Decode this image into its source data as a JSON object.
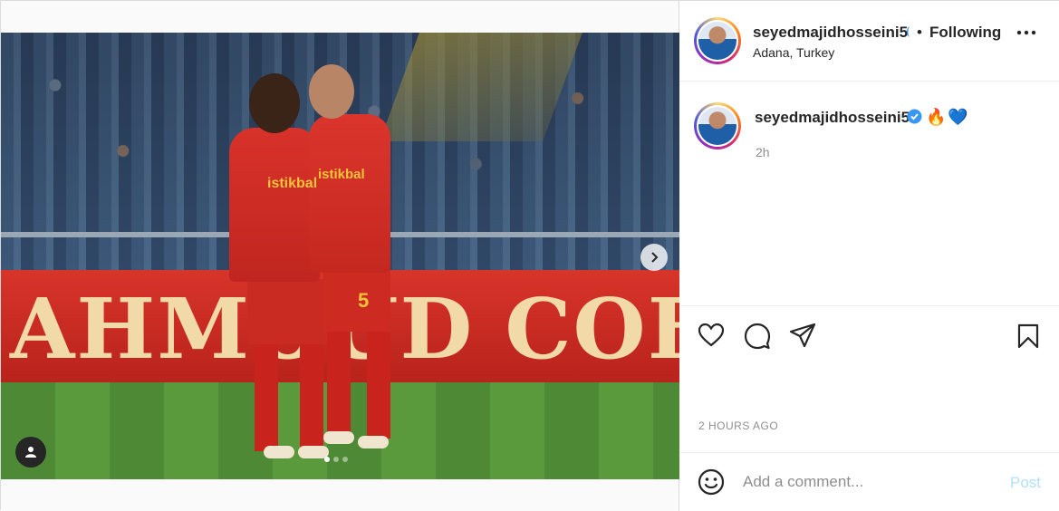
{
  "post": {
    "media": {
      "board_text": "AHMOUD COFF",
      "sponsor_text": "istikbal",
      "sponsor_text_2": "istikbal",
      "jersey_number": "5",
      "carousel": {
        "count": 3,
        "active_index": 0
      }
    },
    "header": {
      "username": "seyedmajidhosseini5",
      "separator": "•",
      "follow_label": "Following",
      "location": "Adana, Turkey"
    },
    "caption": {
      "username": "seyedmajidhosseini5",
      "text": "🔥💙",
      "time": "2h"
    },
    "timestamp": "2 HOURS AGO",
    "comment": {
      "placeholder": "Add a comment...",
      "post_label": "Post"
    }
  },
  "colors": {
    "verified": "#3897f0",
    "post_disabled": "#b2dffc",
    "muted_text": "#8e8e8e"
  },
  "icons": [
    "chevron-right-icon",
    "user-tag-icon",
    "verified-icon",
    "more-icon",
    "heart-icon",
    "comment-icon",
    "share-icon",
    "bookmark-icon",
    "smile-icon"
  ]
}
